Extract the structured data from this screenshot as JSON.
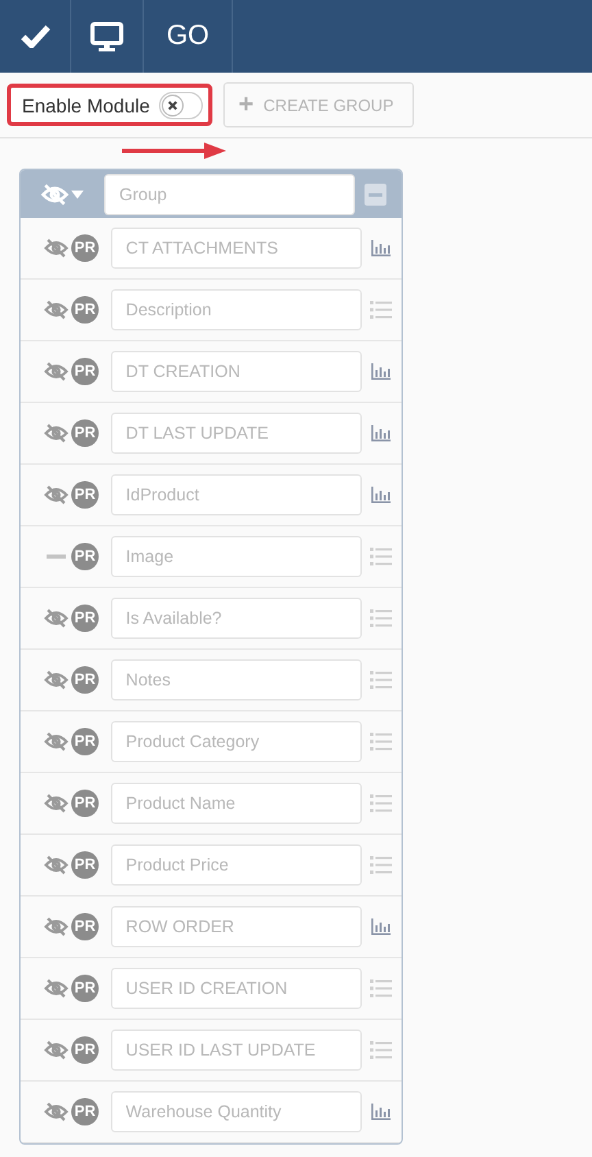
{
  "header": {
    "buttons": [
      {
        "kind": "check"
      },
      {
        "kind": "monitor"
      },
      {
        "kind": "text",
        "label": "GO"
      }
    ]
  },
  "toolbar": {
    "toggle": {
      "label": "Enable Module",
      "on": false
    },
    "create_button": {
      "icon": "+",
      "label": "CREATE GROUP"
    }
  },
  "group": {
    "placeholder": "Group"
  },
  "fields": [
    {
      "hidden": true,
      "badge": "PR",
      "placeholder": "CT ATTACHMENTS",
      "kind": "chart"
    },
    {
      "hidden": true,
      "badge": "PR",
      "placeholder": "Description",
      "kind": "list"
    },
    {
      "hidden": true,
      "badge": "PR",
      "placeholder": "DT CREATION",
      "kind": "chart"
    },
    {
      "hidden": true,
      "badge": "PR",
      "placeholder": "DT LAST UPDATE",
      "kind": "chart"
    },
    {
      "hidden": true,
      "badge": "PR",
      "placeholder": "IdProduct",
      "kind": "chart"
    },
    {
      "hidden": false,
      "badge": "PR",
      "placeholder": "Image",
      "kind": "list"
    },
    {
      "hidden": true,
      "badge": "PR",
      "placeholder": "Is Available?",
      "kind": "list"
    },
    {
      "hidden": true,
      "badge": "PR",
      "placeholder": "Notes",
      "kind": "list"
    },
    {
      "hidden": true,
      "badge": "PR",
      "placeholder": "Product Category",
      "kind": "list"
    },
    {
      "hidden": true,
      "badge": "PR",
      "placeholder": "Product Name",
      "kind": "list"
    },
    {
      "hidden": true,
      "badge": "PR",
      "placeholder": "Product Price",
      "kind": "list"
    },
    {
      "hidden": true,
      "badge": "PR",
      "placeholder": "ROW ORDER",
      "kind": "chart"
    },
    {
      "hidden": true,
      "badge": "PR",
      "placeholder": "USER ID CREATION",
      "kind": "list"
    },
    {
      "hidden": true,
      "badge": "PR",
      "placeholder": "USER ID LAST UPDATE",
      "kind": "list"
    },
    {
      "hidden": true,
      "badge": "PR",
      "placeholder": "Warehouse Quantity",
      "kind": "chart"
    }
  ]
}
